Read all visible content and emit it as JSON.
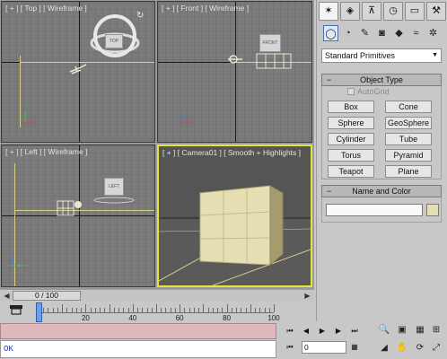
{
  "viewports": {
    "top": "[ + ] [ Top ] [ Wireframe ]",
    "front": "[ + ] [ Front ] [ Wireframe ]",
    "left": "[ + ] [ Left ] [ Wireframe ]",
    "camera": "[ + ] [ Camera01 ] [ Smooth + Highlights ]"
  },
  "viewcube": {
    "top": "TOP",
    "front": "FRONT",
    "left": "LEFT"
  },
  "time_slider": {
    "label": "0 / 100",
    "current": 0,
    "total": 100
  },
  "track": {
    "ticks": [
      "0",
      "20",
      "40",
      "60",
      "80",
      "100"
    ]
  },
  "status": {
    "prompt": "OK"
  },
  "anim": {
    "frame": "0"
  },
  "command_panel": {
    "tabs": [
      "create-icon",
      "modify-icon",
      "hierarchy-icon",
      "motion-icon",
      "display-icon",
      "utilities-icon"
    ],
    "active_tab": "create-icon",
    "category": "Standard Primitives",
    "object_type": {
      "title": "Object Type",
      "autogrid": "AutoGrid",
      "buttons": [
        "Box",
        "Cone",
        "Sphere",
        "GeoSphere",
        "Cylinder",
        "Tube",
        "Torus",
        "Pyramid",
        "Teapot",
        "Plane"
      ]
    },
    "name_color": {
      "title": "Name and Color"
    }
  },
  "colors": {
    "active_border": "#e6e33e",
    "object": "#e7dfb4",
    "status_bar": "#e0b9bd"
  }
}
